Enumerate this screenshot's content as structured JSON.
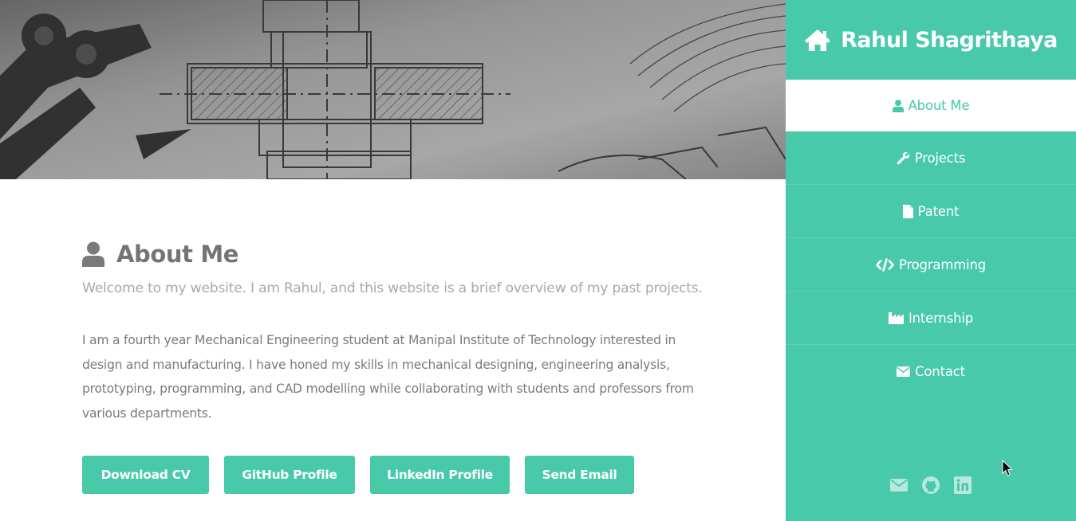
{
  "sidebar": {
    "brand": {
      "name": "Rahul Shagrithaya",
      "icon": "home-icon"
    },
    "items": [
      {
        "label": "About Me",
        "icon": "user-icon",
        "active": true
      },
      {
        "label": "Projects",
        "icon": "wrench-icon"
      },
      {
        "label": "Patent",
        "icon": "file-icon"
      },
      {
        "label": "Programming",
        "icon": "code-icon"
      },
      {
        "label": "Internship",
        "icon": "industry-icon"
      },
      {
        "label": "Contact",
        "icon": "envelope-icon"
      }
    ],
    "social": [
      "email-icon",
      "github-icon",
      "linkedin-icon"
    ]
  },
  "about": {
    "title": "About Me",
    "lead": "Welcome to my website. I am Rahul, and this website is a brief overview of my past projects.",
    "bio": "I am a fourth year Mechanical Engineering student at Manipal Institute of Technology interested in design and manufacturing. I have honed my skills in mechanical designing, engineering analysis, prototyping, programming, and CAD modelling while collaborating with students and professors from various departments."
  },
  "buttons": {
    "download_cv": "Download CV",
    "github": "GitHub Profile",
    "linkedin": "LinkedIn Profile",
    "email": "Send Email"
  },
  "colors": {
    "accent": "#48c9a9",
    "text": "#747474",
    "muted": "#a9a9a9"
  }
}
